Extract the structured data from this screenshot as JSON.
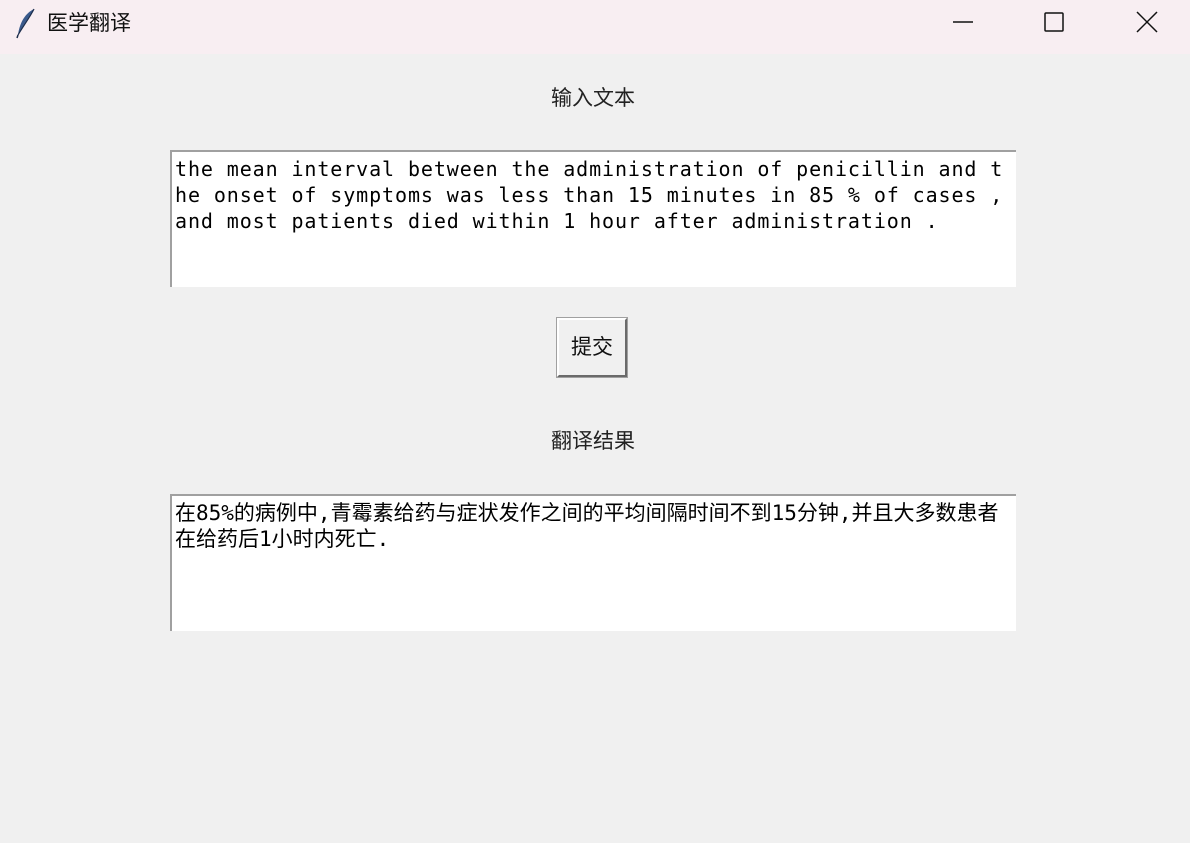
{
  "window": {
    "title": "医学翻译",
    "icon": "feather-icon",
    "controls": {
      "minimize": "minimize-icon",
      "maximize": "maximize-icon",
      "close": "close-icon"
    }
  },
  "input_section": {
    "label": "输入文本",
    "text": "the mean interval between the administration of penicillin and the onset of symptoms was less than 15 minutes in 85 % of cases , and most patients died within 1 hour after administration ."
  },
  "submit_button": {
    "label": "提交"
  },
  "result_section": {
    "label": "翻译结果",
    "text": "在85%的病例中,青霉素给药与症状发作之间的平均间隔时间不到15分钟,并且大多数患者在给药后1小时内死亡."
  },
  "colors": {
    "titlebar_bg": "#f8eef2",
    "window_bg": "#f0f0f0",
    "textbox_bg": "#ffffff"
  }
}
